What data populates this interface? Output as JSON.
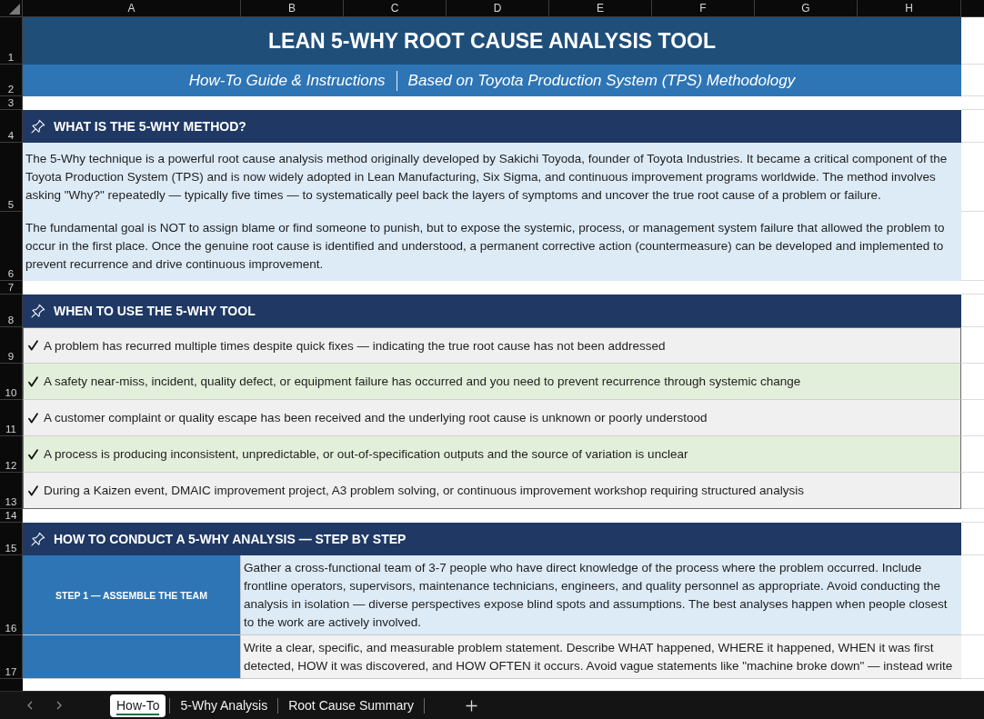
{
  "column_headers": [
    "A",
    "B",
    "C",
    "D",
    "E",
    "F",
    "G",
    "H"
  ],
  "rows": [
    {
      "number": "1",
      "kind": "title",
      "text": "LEAN 5-WHY ROOT CAUSE ANALYSIS TOOL"
    },
    {
      "number": "2",
      "kind": "subtitle",
      "parts": [
        "How-To Guide & Instructions",
        "Based on Toyota Production System (TPS) Methodology"
      ]
    },
    {
      "number": "3",
      "kind": "spacer"
    },
    {
      "number": "4",
      "kind": "section",
      "text": "WHAT IS THE 5-WHY METHOD?"
    },
    {
      "number": "5",
      "kind": "paragraph",
      "text": "The 5-Why technique is a powerful root cause analysis method originally developed by Sakichi Toyoda, founder of Toyota Industries. It became a critical component of the Toyota Production System (TPS) and is now widely adopted in Lean Manufacturing, Six Sigma, and continuous improvement programs worldwide. The method involves asking \"Why?\" repeatedly — typically five times — to systematically peel back the layers of symptoms and uncover the true root cause of a problem or failure."
    },
    {
      "number": "6",
      "kind": "paragraph",
      "text": "The fundamental goal is NOT to assign blame or find someone to punish, but to expose the systemic, process, or management system failure that allowed the problem to occur in the first place. Once the genuine root cause is identified and understood, a permanent corrective action (countermeasure) can be developed and implemented to prevent recurrence and drive continuous improvement."
    },
    {
      "number": "7",
      "kind": "spacer"
    },
    {
      "number": "8",
      "kind": "section",
      "text": "WHEN TO USE THE 5-WHY TOOL"
    },
    {
      "number": "9",
      "kind": "check",
      "text": "A problem has recurred multiple times despite quick fixes — indicating the true root cause has not been addressed"
    },
    {
      "number": "10",
      "kind": "check",
      "text": "A safety near-miss, incident, quality defect, or equipment failure has occurred and you need to prevent recurrence through systemic change"
    },
    {
      "number": "11",
      "kind": "check",
      "text": "A customer complaint or quality escape has been received and the underlying root cause is unknown or poorly understood"
    },
    {
      "number": "12",
      "kind": "check",
      "text": "A process is producing inconsistent, unpredictable, or out-of-specification outputs and the source of variation is unclear"
    },
    {
      "number": "13",
      "kind": "check",
      "text": "During a Kaizen event, DMAIC improvement project, A3 problem solving, or continuous improvement workshop requiring structured analysis"
    },
    {
      "number": "14",
      "kind": "spacer"
    },
    {
      "number": "15",
      "kind": "section",
      "text": "HOW TO CONDUCT A 5-WHY ANALYSIS — STEP BY STEP"
    },
    {
      "number": "16",
      "kind": "step",
      "label": "STEP 1 — ASSEMBLE THE TEAM",
      "text": "Gather a cross-functional team of 3-7 people who have direct knowledge of the process where the problem occurred. Include frontline operators, supervisors, maintenance technicians, engineers, and quality personnel as appropriate. Avoid conducting the analysis in isolation — diverse perspectives expose blind spots and assumptions. The best analyses happen when people closest to the work are actively involved."
    },
    {
      "number": "17",
      "kind": "step",
      "text": "Write a clear, specific, and measurable problem statement. Describe WHAT happened, WHERE it happened, WHEN it was first detected, HOW it was discovered, and HOW OFTEN it occurs. Avoid vague statements like \"machine broke down\" — instead write"
    }
  ],
  "sheet_tabs": [
    {
      "label": "How-To",
      "selected": true
    },
    {
      "label": "5-Why Analysis",
      "selected": false
    },
    {
      "label": "Root Cause Summary",
      "selected": false
    }
  ]
}
